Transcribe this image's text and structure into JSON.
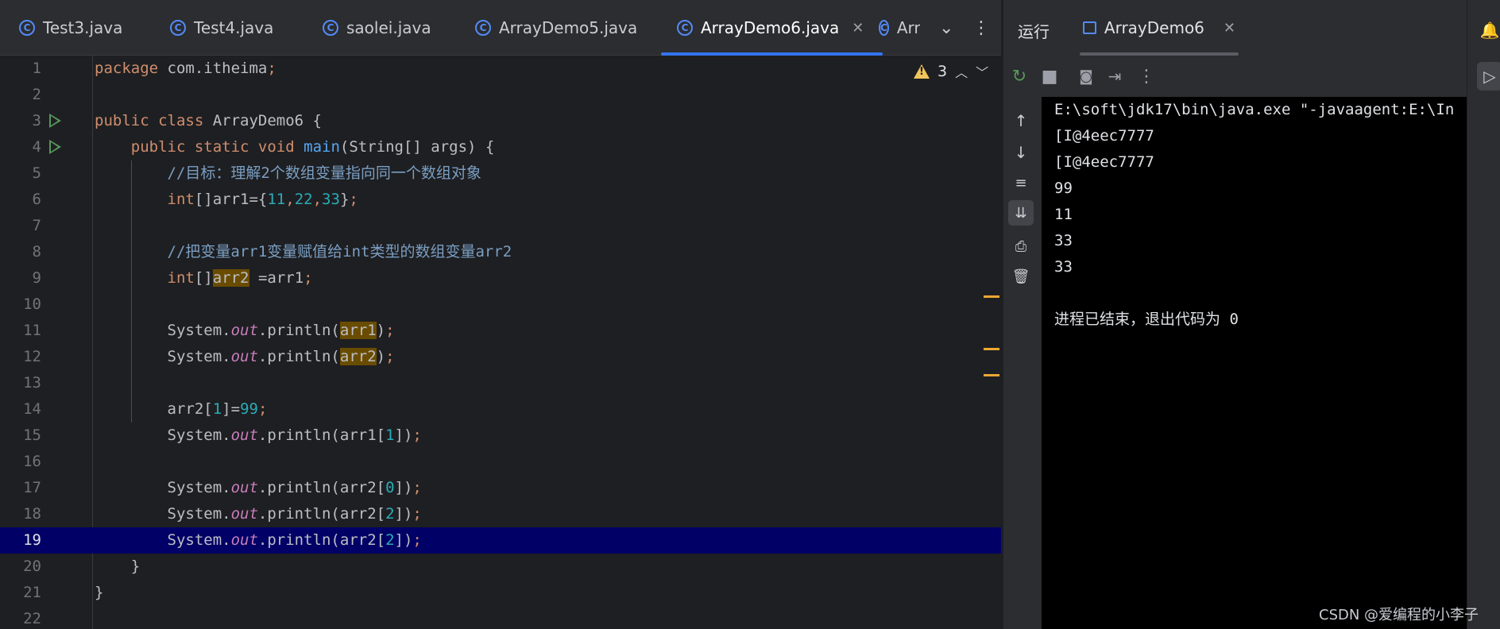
{
  "editor": {
    "tabs": [
      {
        "label": "Test3.java"
      },
      {
        "label": "Test4.java"
      },
      {
        "label": "saolei.java"
      },
      {
        "label": "ArrayDemo5.java"
      },
      {
        "label": "ArrayDemo6.java"
      },
      {
        "label": "Arr"
      }
    ],
    "inspection_count": "3",
    "lines": [
      {
        "n": "1"
      },
      {
        "n": "2"
      },
      {
        "n": "3"
      },
      {
        "n": "4"
      },
      {
        "n": "5"
      },
      {
        "n": "6"
      },
      {
        "n": "7"
      },
      {
        "n": "8"
      },
      {
        "n": "9"
      },
      {
        "n": "10"
      },
      {
        "n": "11"
      },
      {
        "n": "12"
      },
      {
        "n": "13"
      },
      {
        "n": "14"
      },
      {
        "n": "15"
      },
      {
        "n": "16"
      },
      {
        "n": "17"
      },
      {
        "n": "18"
      },
      {
        "n": "19"
      },
      {
        "n": "20"
      },
      {
        "n": "21"
      },
      {
        "n": "22"
      }
    ],
    "code": {
      "l1_kw": "package",
      "l1_rest": " com.itheima",
      "l1_semi": ";",
      "l3_kw": "public class",
      "l3_rest": " ArrayDemo6 {",
      "l4_kw": "public static void",
      "l4_fn": "main",
      "l4_rest": "(String[] args) {",
      "l5_cm": "//目标：理解2个数组变量指向同一个数组对象",
      "l6_kw": "int",
      "l6_a": "[]arr1={",
      "l6_n1": "11",
      "l6_n2": "22",
      "l6_n3": "33",
      "l6_b": "}",
      "l8_cm": "//把变量arr1变量赋值给int类型的数组变量arr2",
      "l9_kw": "int",
      "l9_a": "[]",
      "l9_hl": "arr2",
      "l9_b": " =arr1",
      "sys": "System.",
      "out": "out",
      "println": ".println(",
      "arr1": "arr1",
      "arr2": "arr2",
      "close": ")",
      "l14_a": "arr2[",
      "l14_n": "1",
      "l14_b": "]=",
      "l14_v": "99",
      "l15_a": "arr1[",
      "l15_n": "1",
      "l17_a": "arr2[",
      "l17_n": "0",
      "l18_n": "2",
      "l19_n": "2",
      "idx_close": "])",
      "semi": ";",
      "l20": "}",
      "l21": "}"
    }
  },
  "run": {
    "title": "运行",
    "tab_label": "ArrayDemo6",
    "console": [
      "E:\\soft\\jdk17\\bin\\java.exe \"-javaagent:E:\\In",
      "[I@4eec7777",
      "[I@4eec7777",
      "99",
      "11",
      "33",
      "33",
      "",
      "进程已结束，退出代码为 0"
    ]
  },
  "watermark": "CSDN @爱编程的小李子",
  "colors": {
    "accent": "#3574f0",
    "current_line": "#000066",
    "keyword": "#cf8e6d",
    "number": "#2aacb8",
    "comment": "#7a9ec2",
    "static_field": "#c77dbb",
    "highlight": "#6a4c00",
    "warning": "#f2c55c"
  }
}
